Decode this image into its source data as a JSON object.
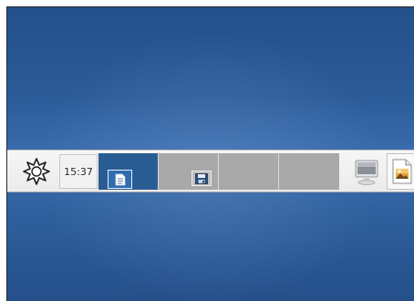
{
  "panel": {
    "menu": {
      "icon": "sun-gear-menu-icon"
    },
    "clock": {
      "time": "15:37"
    },
    "pager": {
      "workspaces": [
        {
          "active": true,
          "windows": [
            "document-icon"
          ]
        },
        {
          "active": false,
          "windows": [
            "floppy-save-icon"
          ]
        },
        {
          "active": false,
          "windows": []
        },
        {
          "active": false,
          "windows": []
        }
      ]
    },
    "launchers": [
      {
        "icon": "monitor-icon"
      },
      {
        "icon": "image-viewer-icon"
      }
    ]
  },
  "colors": {
    "desktop": "#2b5b98",
    "panel": "#efefef",
    "workspace_active": "#2a5c94",
    "workspace_inactive": "#a9a9a9"
  }
}
